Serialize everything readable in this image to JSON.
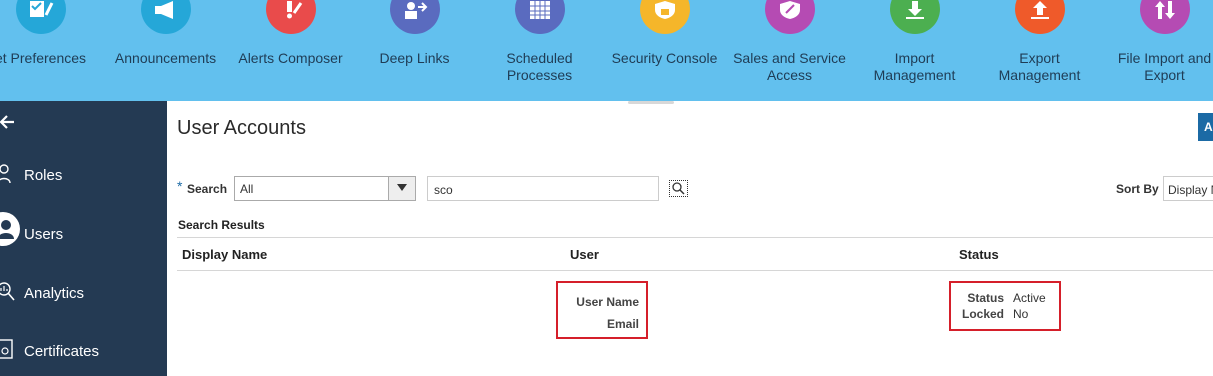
{
  "springboard": {
    "items": [
      {
        "label": "et Preferences",
        "color": "#25a7d8",
        "icon": "checklist-icon"
      },
      {
        "label": "Announcements",
        "color": "#25a7d8",
        "icon": "megaphone-icon"
      },
      {
        "label": "Alerts Composer",
        "color": "#e94b4b",
        "icon": "alert-icon"
      },
      {
        "label": "Deep Links",
        "color": "#5a6bbf",
        "icon": "deep-links-icon"
      },
      {
        "label": "Scheduled Processes",
        "color": "#5a6bbf",
        "icon": "calendar-icon"
      },
      {
        "label": "Security Console",
        "color": "#f5b62a",
        "icon": "shield-lock-icon"
      },
      {
        "label": "Sales and Service Access",
        "color": "#b54bb3",
        "icon": "shield-icon"
      },
      {
        "label": "Import Management",
        "color": "#4caf50",
        "icon": "download-icon"
      },
      {
        "label": "Export Management",
        "color": "#ef5a2a",
        "icon": "upload-icon"
      },
      {
        "label": "File Import and Export",
        "color": "#b54bb3",
        "icon": "transfer-icon"
      }
    ]
  },
  "nav": {
    "items": [
      {
        "label": "Roles",
        "icon": "roles-icon"
      },
      {
        "label": "Users",
        "icon": "user-icon"
      },
      {
        "label": "Analytics",
        "icon": "analytics-icon"
      },
      {
        "label": "Certificates",
        "icon": "certificate-icon"
      }
    ]
  },
  "page": {
    "title": "User Accounts",
    "add_label": "A"
  },
  "search": {
    "required_mark": "*",
    "label": "Search",
    "filter_value": "All",
    "query": "sco",
    "sort_label": "Sort By",
    "sort_value": "Display N"
  },
  "results": {
    "header": "Search Results",
    "columns": [
      "Display Name",
      "User",
      "Status"
    ],
    "user_fields": {
      "name_label": "User Name",
      "email_label": "Email"
    },
    "status_fields": {
      "status_label": "Status",
      "status_value": "Active",
      "locked_label": "Locked",
      "locked_value": "No"
    }
  },
  "colors": {
    "springboard_bg": "#62c0ee",
    "nav_bg": "#243a53",
    "highlight": "#d51f2a",
    "accent": "#1b6aa5"
  }
}
